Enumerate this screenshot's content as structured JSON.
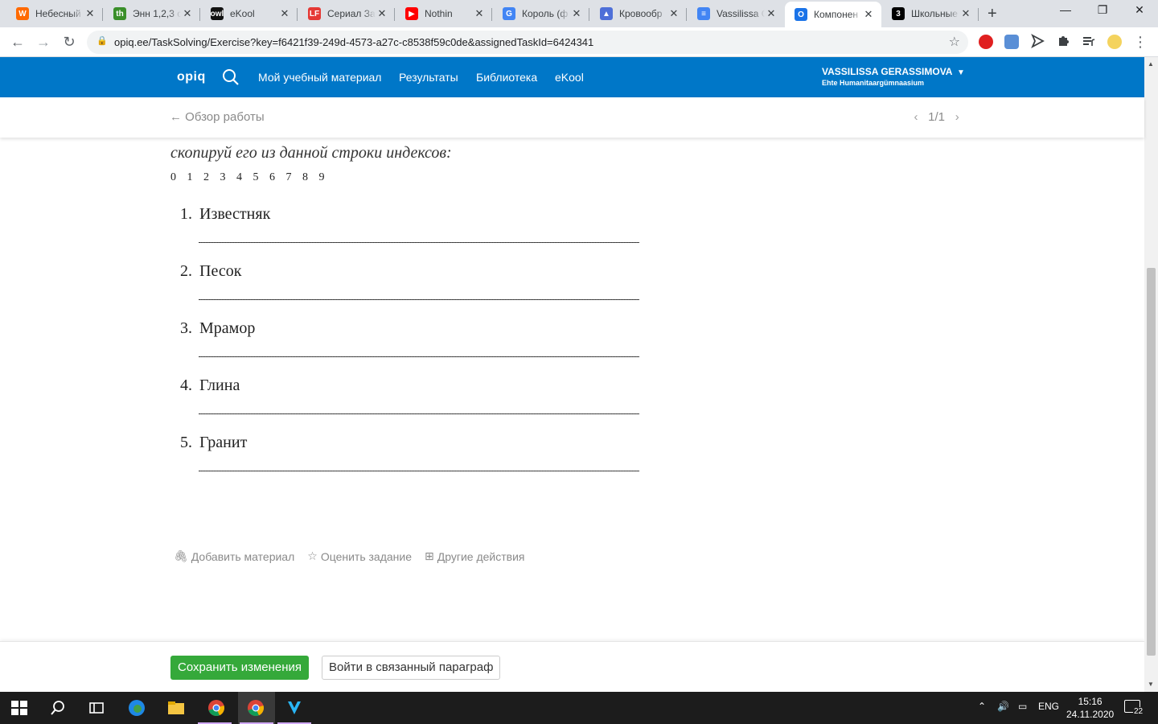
{
  "browser": {
    "tabs": [
      {
        "title": "Небесный",
        "favicon": "W",
        "color": "#ff6a00"
      },
      {
        "title": "Энн 1,2,3 с",
        "favicon": "th",
        "color": "#3a8f2a"
      },
      {
        "title": "eKool",
        "favicon": "owl",
        "color": "#111111"
      },
      {
        "title": "Сериал За",
        "favicon": "LF",
        "color": "#e53935"
      },
      {
        "title": "Nothin",
        "favicon": "▶",
        "color": "#ff0000"
      },
      {
        "title": "Король (ф",
        "favicon": "G",
        "color": "#4285f4"
      },
      {
        "title": "Кровообр",
        "favicon": "▲",
        "color": "#4e6fd8"
      },
      {
        "title": "Vassilissa C",
        "favicon": "≡",
        "color": "#4285f4"
      },
      {
        "title": "Компонен",
        "favicon": "O",
        "color": "#1a73e8"
      },
      {
        "title": "Школьные",
        "favicon": "3",
        "color": "#000000"
      }
    ],
    "url": "opiq.ee/TaskSolving/Exercise?key=f6421f39-249d-4573-a27c-c8538f59c0de&assignedTaskId=6424341"
  },
  "header": {
    "logo": "opiq",
    "nav": [
      "Мой учебный материал",
      "Результаты",
      "Библиотека",
      "eKool"
    ],
    "user_name": "VASSILISSA GERASSIMOVA",
    "school": "Ehte Humanitaargümnaasium"
  },
  "subbar": {
    "back_label": "Обзор работы",
    "pager": "1/1"
  },
  "exercise": {
    "instruction": "скопируй его из данной строки индексов:",
    "indices": "0 1 2 3 4 5 6 7 8 9",
    "items": [
      {
        "num": "1.",
        "word": "Известняк"
      },
      {
        "num": "2.",
        "word": "Песок"
      },
      {
        "num": "3.",
        "word": "Мрамор"
      },
      {
        "num": "4.",
        "word": "Глина"
      },
      {
        "num": "5.",
        "word": "Гранит"
      }
    ]
  },
  "actions": {
    "add_material": "Добавить материал",
    "rate_task": "Оценить задание",
    "other_actions": "Другие действия"
  },
  "footer": {
    "save": "Сохранить изменения",
    "paragraph": "Войти в связанный параграф"
  },
  "taskbar": {
    "lang": "ENG",
    "time": "15:16",
    "date": "24.11.2020",
    "notifications": "22"
  },
  "colors": {
    "opiq_blue": "#0077c8",
    "save_green": "#35a93a"
  }
}
